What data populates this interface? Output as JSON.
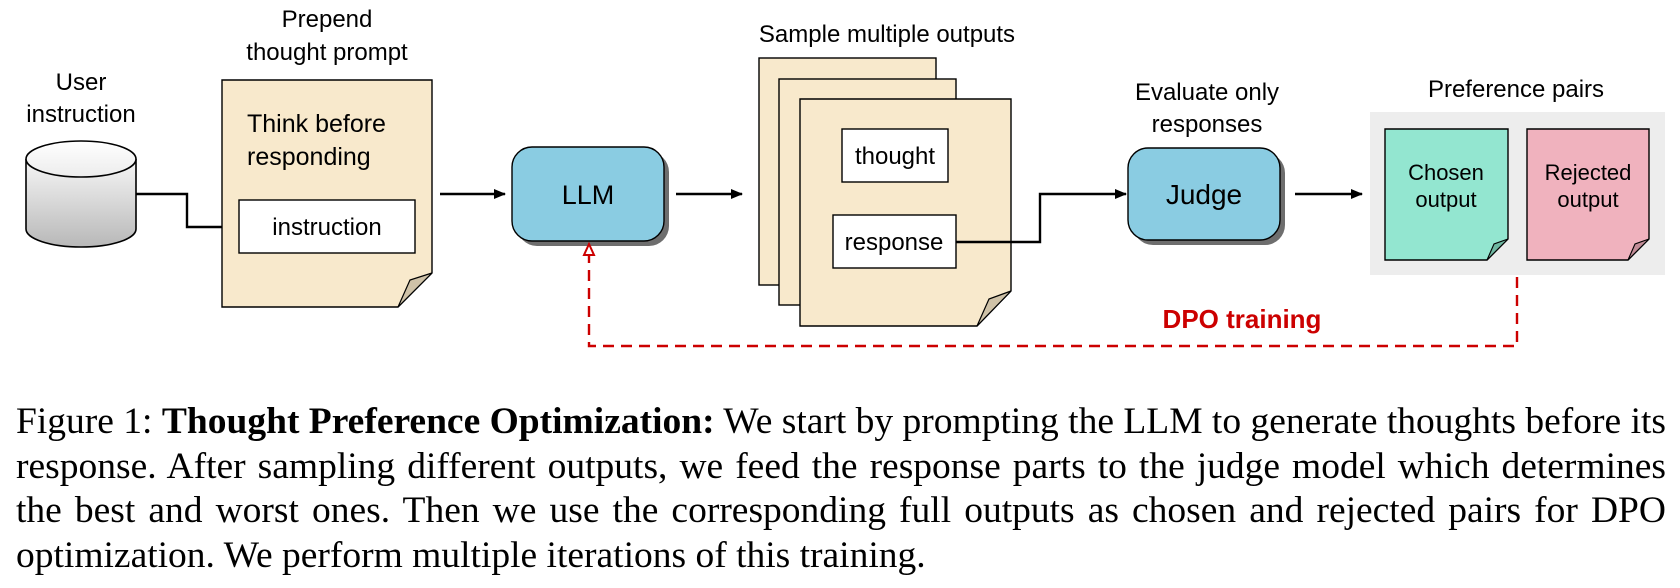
{
  "diagram": {
    "user_instruction": {
      "label_line1": "User",
      "label_line2": "instruction"
    },
    "prompt_doc": {
      "title_line1": "Prepend",
      "title_line2": "thought prompt",
      "body_line1": "Think before",
      "body_line2": "responding",
      "inner_box": "instruction"
    },
    "llm": {
      "label": "LLM"
    },
    "samples": {
      "title": "Sample multiple outputs",
      "thought_box": "thought",
      "response_box": "response"
    },
    "judge": {
      "title_line1": "Evaluate only",
      "title_line2": "responses",
      "label": "Judge"
    },
    "preference": {
      "title": "Preference pairs",
      "chosen_line1": "Chosen",
      "chosen_line2": "output",
      "rejected_line1": "Rejected",
      "rejected_line2": "output"
    },
    "feedback": {
      "label": "DPO training"
    },
    "colors": {
      "doc_fill": "#f8e9cc",
      "fold_fill": "#cfc2a8",
      "box_blue": "#8accE2",
      "chosen_fill": "#93e6d0",
      "rejected_fill": "#f0b2be",
      "panel_bg": "#ededed",
      "dpo_red": "#cc0000"
    }
  },
  "caption": {
    "prefix": "Figure 1: ",
    "bold": "Thought Preference Optimization:",
    "text": " We start by prompting the LLM to generate thoughts before its response. After sampling different outputs, we feed the response parts to the judge model which determines the best and worst ones. Then we use the corresponding full outputs as chosen and rejected pairs for DPO optimization. We perform multiple iterations of this training."
  }
}
